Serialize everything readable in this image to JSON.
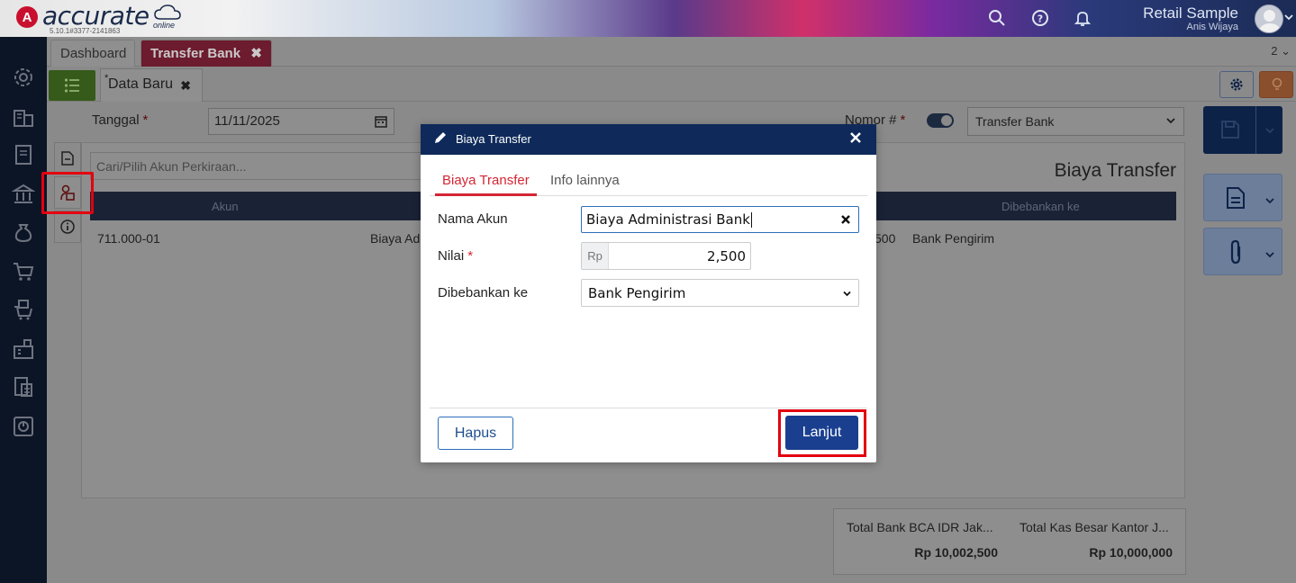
{
  "header": {
    "logo_mark": "A",
    "logo_text": "accurate",
    "logo_sub": "online",
    "version": "5.10.1#3377-2141863",
    "company": "Retail Sample",
    "user": "Anis Wijaya"
  },
  "tabs": {
    "dashboard": "Dashboard",
    "transfer_bank": "Transfer Bank",
    "close": "✖",
    "count": "2 ⌄"
  },
  "doc_tab": {
    "star": "*",
    "label": "Data Baru",
    "close": "✖"
  },
  "form": {
    "tanggal_label": "Tanggal",
    "required_mark": "*",
    "tanggal_value": "11/11/2025",
    "nomor_label": "Nomor #",
    "nomor_toggle_on": true,
    "nomor_select": "Transfer Bank"
  },
  "panel": {
    "search_placeholder": "Cari/Pilih Akun Perkiraan...",
    "title": "Biaya Transfer",
    "columns": [
      "Akun",
      "Dibebankan ke"
    ],
    "row": {
      "akun": "711.000-01",
      "nama": "Biaya Ad",
      "nilai": "500",
      "dibebankan": "Bank Pengirim"
    }
  },
  "totals": {
    "label_1": "Total Bank BCA IDR Jak...",
    "value_1": "Rp 10,002,500",
    "label_2": "Total Kas Besar Kantor J...",
    "value_2": "Rp 10,000,000"
  },
  "modal": {
    "title": "Biaya Transfer",
    "tab_active": "Biaya Transfer",
    "tab_other": "Info lainnya",
    "nama_akun_label": "Nama Akun",
    "nama_akun_value": "Biaya Administrasi Bank",
    "nilai_label": "Nilai",
    "required_mark": "*",
    "currency": "Rp",
    "nilai_value": "2,500",
    "dibebankan_label": "Dibebankan ke",
    "dibebankan_value": "Bank Pengirim",
    "hapus_label": "Hapus",
    "lanjut_label": "Lanjut"
  },
  "colors": {
    "accent_red": "#d42533",
    "primary_blue": "#1a3f8f",
    "header_navy": "#0f2a5a",
    "highlight": "#e3000f"
  }
}
